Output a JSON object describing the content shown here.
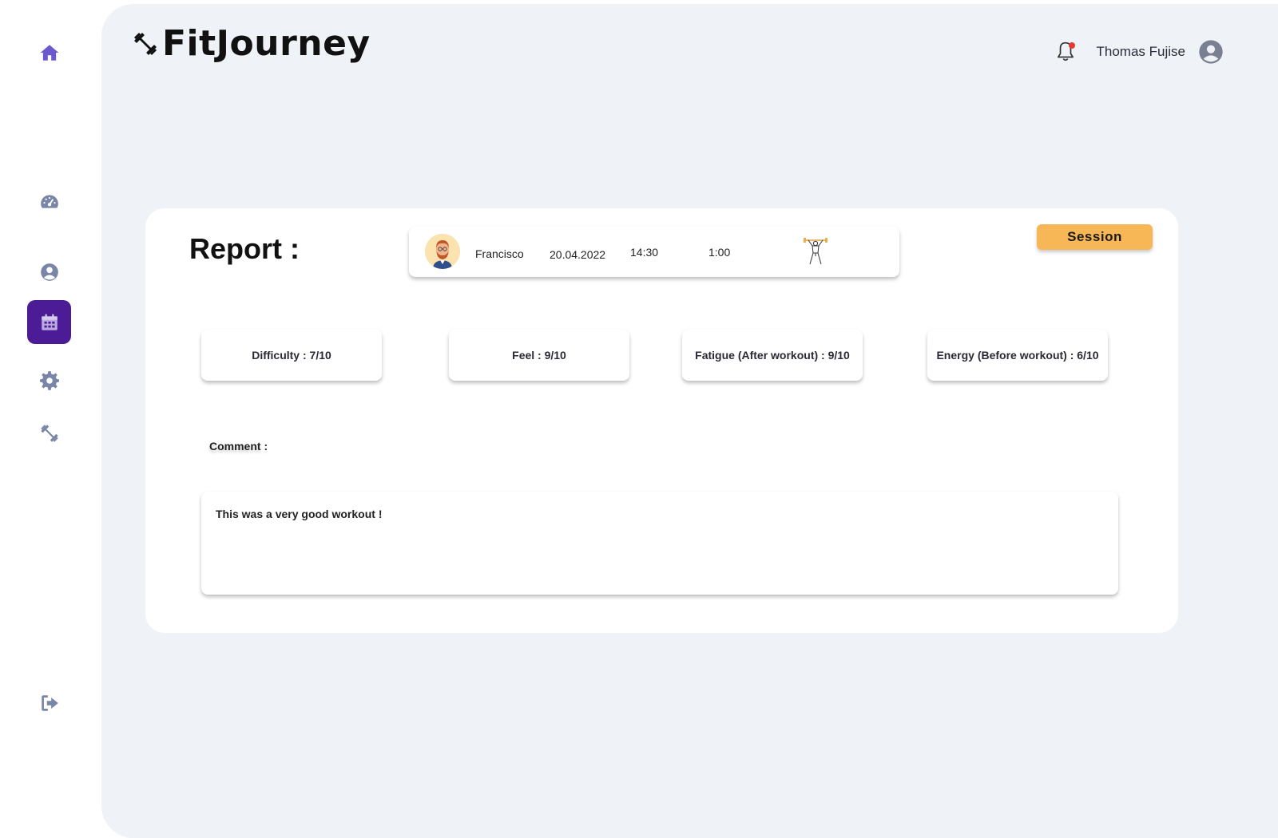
{
  "app": {
    "name": "FitJourney"
  },
  "header": {
    "user_name": "Thomas Fujise"
  },
  "sidebar": {
    "items": [
      {
        "icon": "home-icon",
        "active": false
      },
      {
        "icon": "dashboard-icon",
        "active": false
      },
      {
        "icon": "user-circle-icon",
        "active": false
      },
      {
        "icon": "calendar-icon",
        "active": true
      },
      {
        "icon": "gear-icon",
        "active": false
      },
      {
        "icon": "dumbbell-icon",
        "active": false
      },
      {
        "icon": "logout-icon",
        "active": false
      }
    ]
  },
  "report": {
    "title": "Report :",
    "session_info": {
      "coach": "Francisco",
      "date": "20.04.2022",
      "time": "14:30",
      "duration": "1:00"
    },
    "badge": "Session",
    "metrics": {
      "difficulty": "Difficulty : 7/10",
      "feel": "Feel  : 9/10",
      "fatigue": "Fatigue (After workout)  : 9/10",
      "energy": "Energy (Before workout) : 6/10"
    },
    "comment_label": "Comment :",
    "comment_text": "This was a very good workout !"
  },
  "colors": {
    "accent": "#4b1c96",
    "nav_icon": "#7a86a8",
    "home_icon": "#6a5acd",
    "badge": "#f7b757",
    "background": "#eff2f7"
  }
}
